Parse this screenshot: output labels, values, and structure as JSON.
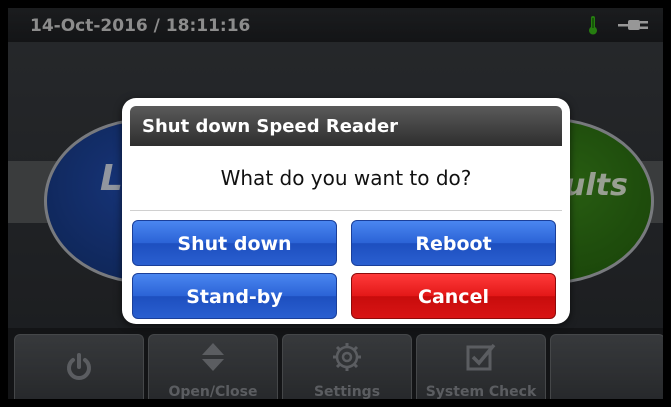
{
  "statusbar": {
    "datetime": "14-Oct-2016 / 18:11:16",
    "icons": [
      "thermometer-icon",
      "power-plug-icon"
    ]
  },
  "background": {
    "left_tile_text": "L",
    "right_tile_text": "ults"
  },
  "toolbar": {
    "power_icon": "power-icon",
    "open_close_label": "Open/Close",
    "settings_label": "Settings",
    "system_check_label": "System Check"
  },
  "dialog": {
    "title": "Shut down Speed Reader",
    "message": "What do you want to do?",
    "buttons": {
      "shutdown": "Shut down",
      "reboot": "Reboot",
      "standby": "Stand-by",
      "cancel": "Cancel"
    }
  },
  "colors": {
    "blue_button": "#2b63d6",
    "red_button": "#e31818",
    "thermometer": "#3bc21a"
  }
}
